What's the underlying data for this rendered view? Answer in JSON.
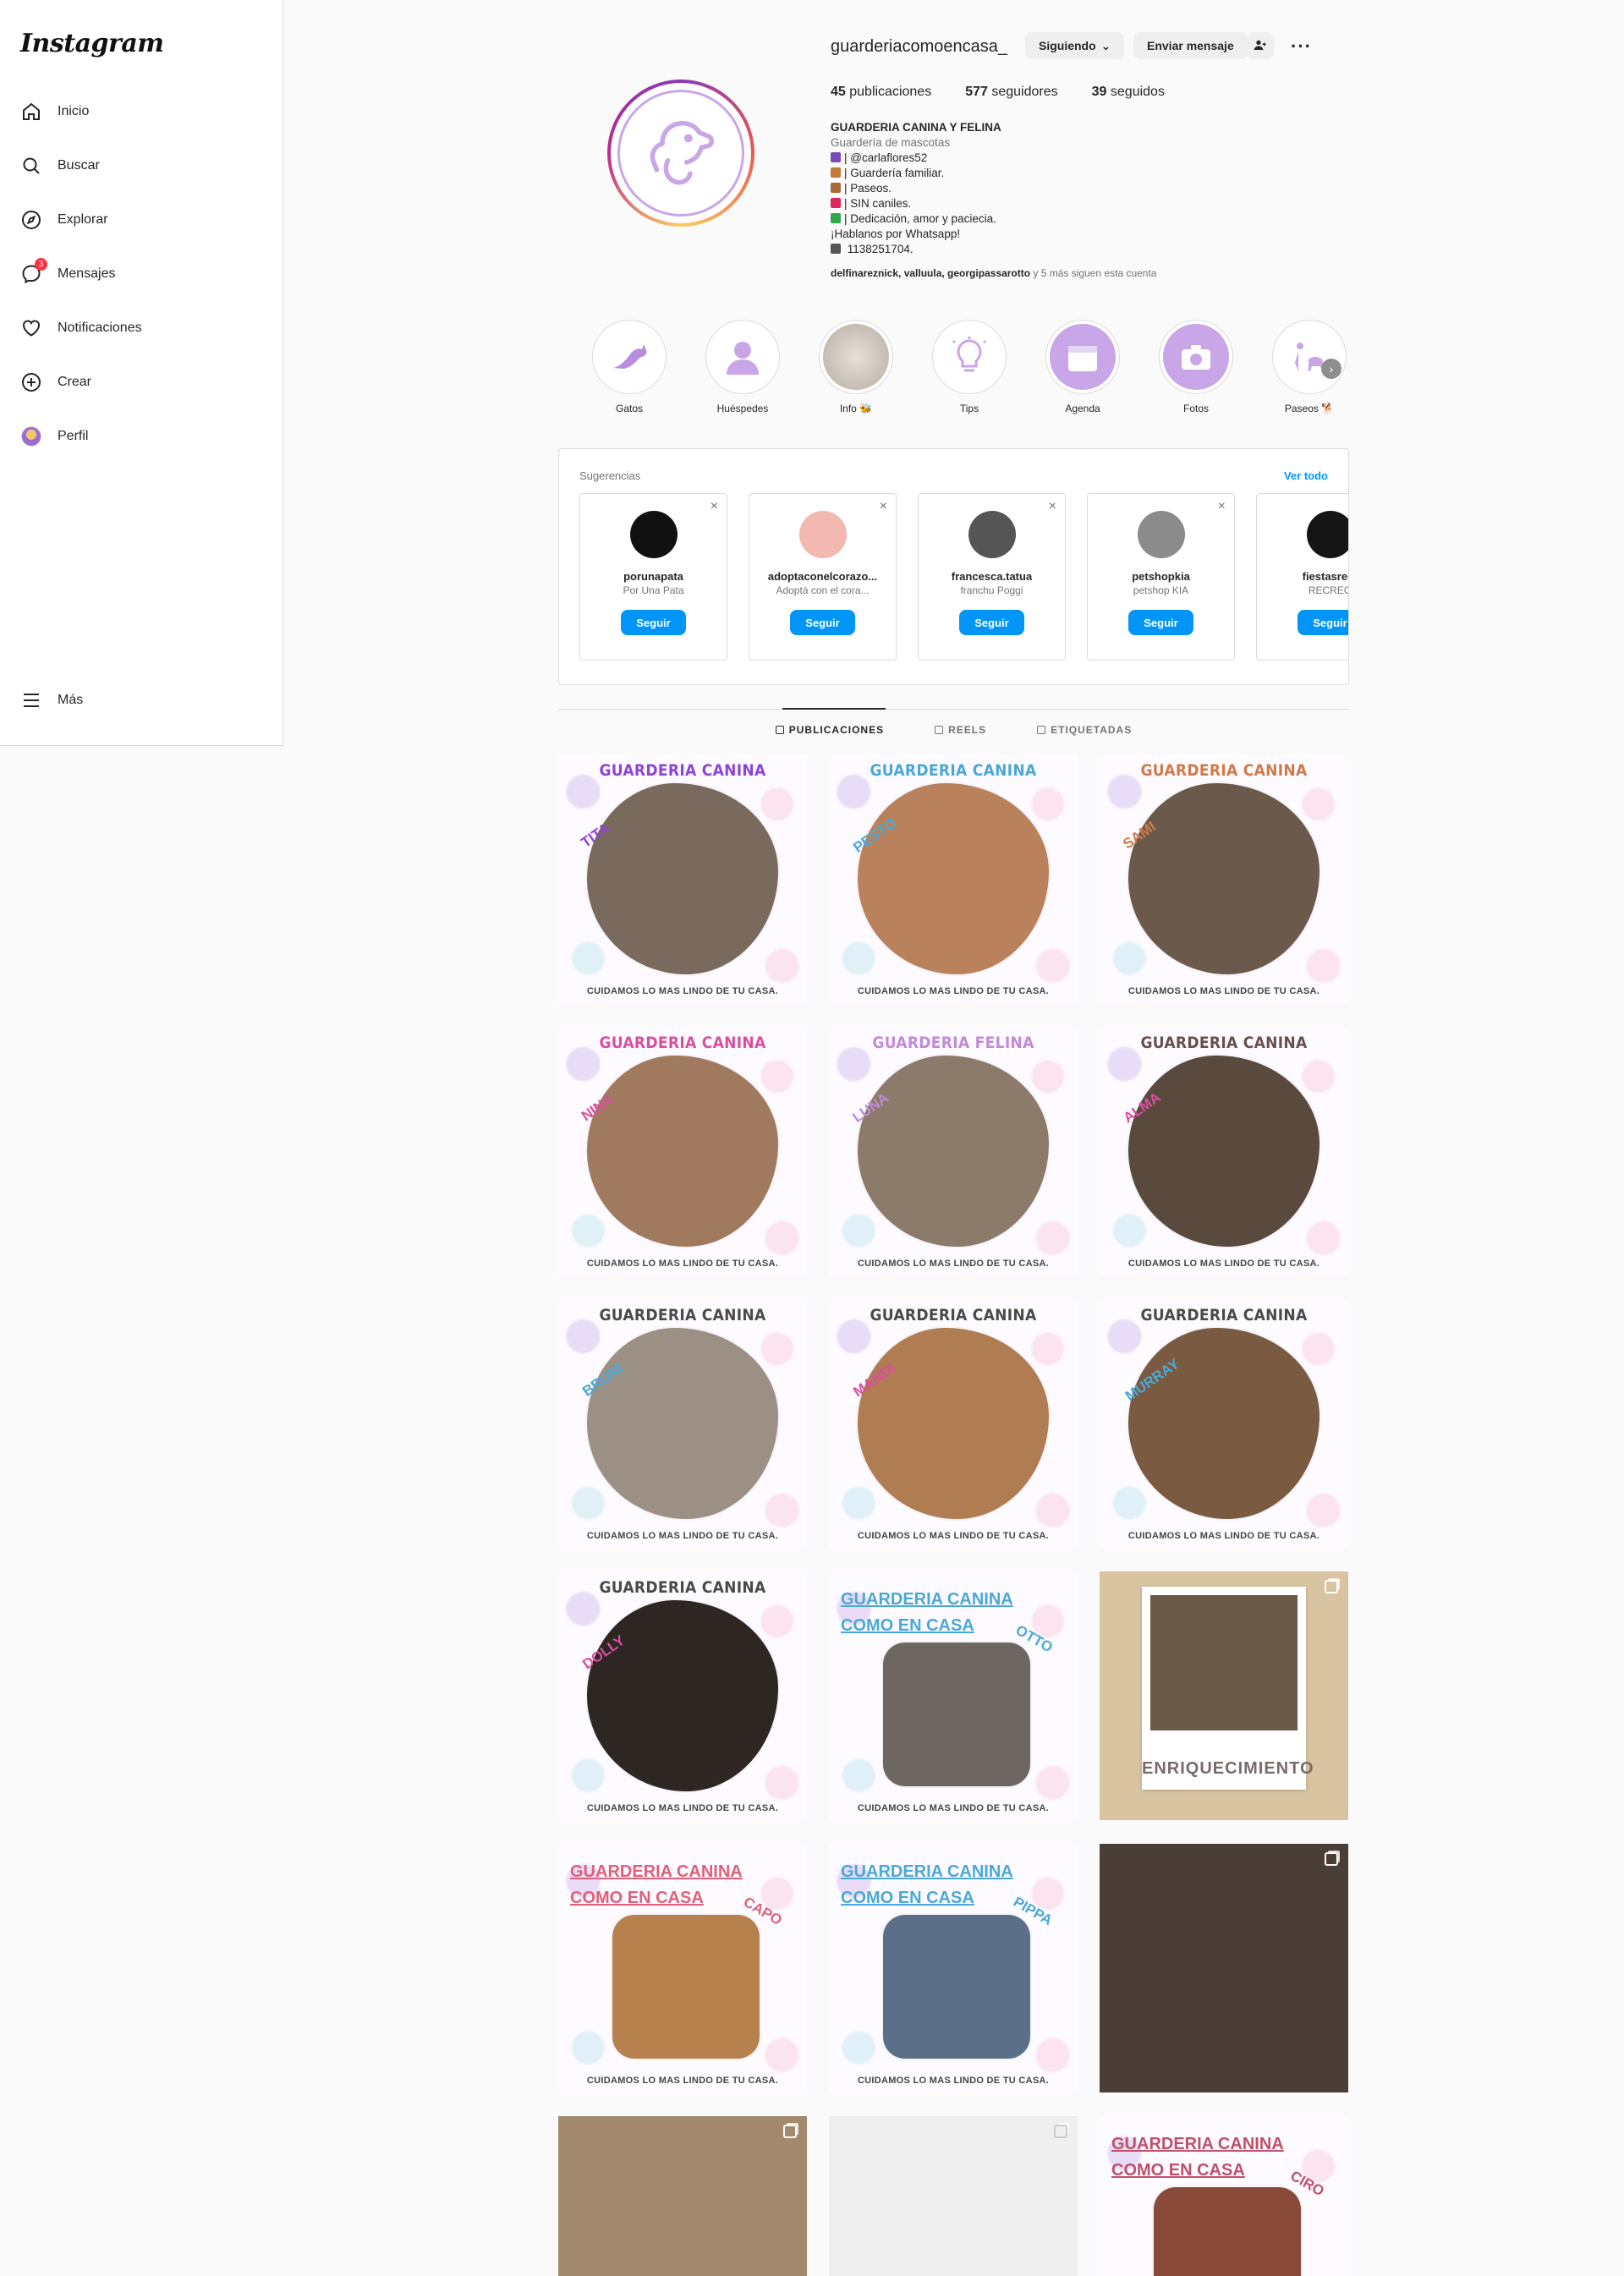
{
  "sidebar": {
    "logo": "Instagram",
    "items": [
      {
        "label": "Inicio",
        "icon": "home-icon"
      },
      {
        "label": "Buscar",
        "icon": "search-icon"
      },
      {
        "label": "Explorar",
        "icon": "compass-icon"
      },
      {
        "label": "Mensajes",
        "icon": "messenger-icon",
        "badge": "3"
      },
      {
        "label": "Notificaciones",
        "icon": "heart-icon"
      },
      {
        "label": "Crear",
        "icon": "plus-square-icon"
      },
      {
        "label": "Perfil",
        "icon": "avatar"
      }
    ],
    "more": "Más"
  },
  "profile": {
    "username": "guarderiacomoencasa_",
    "following_button": "Siguiendo",
    "message_button": "Enviar mensaje",
    "stats": [
      {
        "count": "45",
        "label": "publicaciones"
      },
      {
        "count": "577",
        "label": "seguidores"
      },
      {
        "count": "39",
        "label": "seguidos"
      }
    ],
    "full_name": "GUARDERIA CANINA Y FELINA",
    "category": "Guardería de mascotas",
    "bio_lines": [
      {
        "text": "| @carlaflores52",
        "color": "#7b4bb7"
      },
      {
        "text": "| Guardería familiar.",
        "color": "#c47b3a"
      },
      {
        "text": "| Paseos.",
        "color": "#a56b38"
      },
      {
        "text": "| SIN caniles.",
        "color": "#e0245e"
      },
      {
        "text": "| Dedicación, amor y paciecia.",
        "color": "#2ea84a"
      },
      {
        "text": "¡Hablanos por Whatsapp!",
        "color": ""
      },
      {
        "text": " 1138251704.",
        "color": "#555555"
      }
    ],
    "followed_by_names": "delfinareznick, valluula, georgipassarotto",
    "followed_by_rest": " y 5 más siguen esta cuenta"
  },
  "highlights": [
    {
      "label": "Gatos"
    },
    {
      "label": "Huéspedes"
    },
    {
      "label": "Info 🐝"
    },
    {
      "label": "Tips"
    },
    {
      "label": "Agenda"
    },
    {
      "label": "Fotos"
    },
    {
      "label": "Paseos 🐕"
    }
  ],
  "suggestions": {
    "title": "Sugerencias",
    "see_all": "Ver todo",
    "follow_label": "Seguir",
    "cards": [
      {
        "name": "porunapata",
        "sub": "Por Una Pata",
        "color": "#111111"
      },
      {
        "name": "adoptaconelcorazo...",
        "sub": "Adoptá con el cora...",
        "color": "#f3b8b0"
      },
      {
        "name": "francesca.tatua",
        "sub": "franchu Poggi",
        "color": "#555555"
      },
      {
        "name": "petshopkia",
        "sub": "petshop KIA",
        "color": "#8b8b8b"
      },
      {
        "name": "fiestasrecr",
        "sub": "RECREO",
        "color": "#151515"
      }
    ]
  },
  "tabs": [
    {
      "label": "PUBLICACIONES",
      "active": true
    },
    {
      "label": "REELS",
      "active": false
    },
    {
      "label": "ETIQUETADAS",
      "active": false
    }
  ],
  "posts": [
    {
      "kind": "card",
      "title": "GUARDERIA CANINA",
      "title_color": "#8e44d6",
      "name": "TITA",
      "name_color": "#8e44d6",
      "blob": "#7a6a5e",
      "footer": "CUIDAMOS LO MAS LINDO DE TU CASA."
    },
    {
      "kind": "card",
      "title": "GUARDERIA CANINA",
      "title_color": "#4aa8d8",
      "name": "PESTO",
      "name_color": "#4aa8d8",
      "blob": "#b9825c",
      "footer": "CUIDAMOS LO MAS LINDO DE TU CASA."
    },
    {
      "kind": "card",
      "title": "GUARDERIA CANINA",
      "title_color": "#d07a4a",
      "name": "SAMI",
      "name_color": "#d07a4a",
      "blob": "#6b5a4b",
      "footer": "CUIDAMOS LO MAS LINDO DE TU CASA."
    },
    {
      "kind": "card",
      "title": "GUARDERIA CANINA",
      "title_color": "#d94fa0",
      "name": "NINA",
      "name_color": "#d94fa0",
      "blob": "#a07a5e",
      "footer": "CUIDAMOS LO MAS LINDO DE TU CASA."
    },
    {
      "kind": "card",
      "title": "GUARDERIA FELINA",
      "title_color": "#c28ad8",
      "name": "LUNA",
      "name_color": "#c28ad8",
      "blob": "#8c7b6a",
      "footer": "CUIDAMOS LO MAS LINDO DE TU CASA."
    },
    {
      "kind": "card",
      "title": "GUARDERIA CANINA",
      "title_color": "#6a4f4f",
      "name": "ALMA",
      "name_color": "#d94fa0",
      "blob": "#5a4a3e",
      "footer": "CUIDAMOS LO MAS LINDO DE TU CASA."
    },
    {
      "kind": "card",
      "title": "GUARDERIA CANINA",
      "title_color": "#4a4a4a",
      "name": "BRUNI",
      "name_color": "#4aa8d8",
      "blob": "#9c8f84",
      "footer": "CUIDAMOS LO MAS LINDO DE TU CASA."
    },
    {
      "kind": "card",
      "title": "GUARDERIA CANINA",
      "title_color": "#4a4a4a",
      "name": "MANDI",
      "name_color": "#d94fa0",
      "blob": "#b07c52",
      "footer": "CUIDAMOS LO MAS LINDO DE TU CASA."
    },
    {
      "kind": "card",
      "title": "GUARDERIA CANINA",
      "title_color": "#4a4a4a",
      "name": "MURRAY",
      "name_color": "#4aa8d8",
      "blob": "#7a5a40",
      "footer": "CUIDAMOS LO MAS LINDO DE TU CASA."
    },
    {
      "kind": "card",
      "title": "GUARDERIA CANINA",
      "title_color": "#4a4a4a",
      "name": "DOLLY",
      "name_color": "#d94fa0",
      "blob": "#2e2622",
      "footer": "CUIDAMOS LO MAS LINDO DE TU CASA."
    },
    {
      "kind": "card2",
      "title1": "GUARDERIA CANINA",
      "title2": "COMO EN CASA",
      "title_color": "#4aa8d8",
      "name": "OTTO",
      "name_color": "#4aa8d8",
      "blob": "#6e6660",
      "footer": "CUIDAMOS LO MAS LINDO DE TU CASA."
    },
    {
      "kind": "polaroid",
      "caption": "ENRIQUECIMIENTO",
      "photo": "#6b5a48",
      "bg": "#d8c4a0"
    },
    {
      "kind": "card2",
      "title1": "GUARDERIA CANINA",
      "title2": "COMO EN CASA",
      "title_color": "#e0607a",
      "name": "CAPO",
      "name_color": "#e0607a",
      "blob": "#b6814c",
      "footer": "CUIDAMOS LO MAS LINDO DE TU CASA."
    },
    {
      "kind": "card2",
      "title1": "GUARDERIA CANINA",
      "title2": "COMO EN CASA",
      "title_color": "#4aa8d8",
      "name": "PIPPA",
      "name_color": "#4aa8d8",
      "blob": "#5b6f88",
      "footer": "CUIDAMOS LO MAS LINDO DE TU CASA."
    },
    {
      "kind": "photo",
      "bg": "#4a3e36"
    },
    {
      "kind": "photo",
      "bg": "#a3896e"
    },
    {
      "kind": "empty",
      "bg": "#efefef"
    },
    {
      "kind": "card2",
      "title1": "GUARDERIA CANINA",
      "title2": "COMO EN CASA",
      "title_color": "#c0506a",
      "name": "CIRO",
      "name_color": "#c0506a",
      "blob": "#8a4a3a",
      "footer": ""
    }
  ]
}
